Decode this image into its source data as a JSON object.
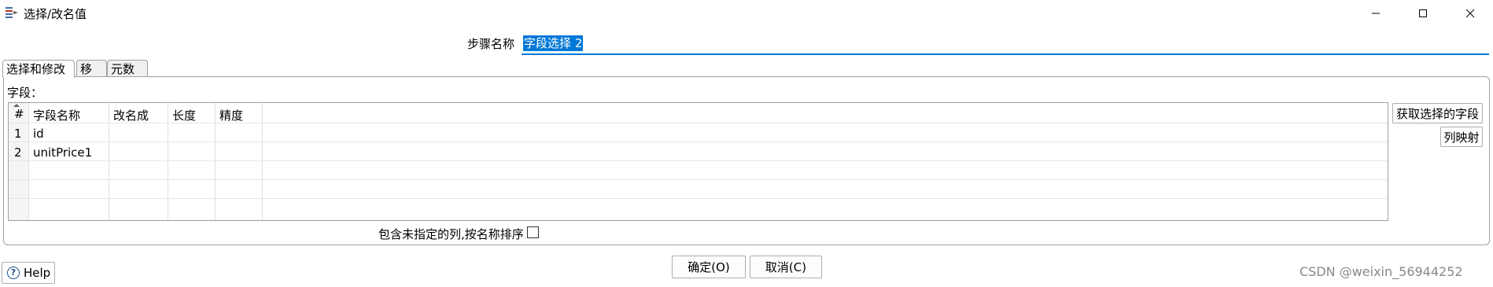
{
  "window": {
    "title": "选择/改名值",
    "icon": "select-values-icon"
  },
  "step": {
    "label": "步骤名称",
    "value": "字段选择 2"
  },
  "tabs": [
    {
      "label": "选择和修改",
      "active": true
    },
    {
      "label": "移除",
      "active": false
    },
    {
      "label": "元数据",
      "active": false
    }
  ],
  "fields_label": "字段：",
  "table": {
    "headers": [
      "#",
      "字段名称",
      "改名成",
      "长度",
      "精度"
    ],
    "rows": [
      {
        "num": "1",
        "name": "id",
        "rename": "",
        "length": "",
        "precision": ""
      },
      {
        "num": "2",
        "name": "unitPrice1",
        "rename": "",
        "length": "",
        "precision": ""
      }
    ]
  },
  "buttons": {
    "get_fields": "获取选择的字段",
    "column_mapping": "列映射",
    "help": "Help",
    "ok": "确定(O)",
    "cancel": "取消(C)"
  },
  "include_unspecified": {
    "label": "包含未指定的列,按名称排序",
    "checked": false
  },
  "watermark": "CSDN @weixin_56944252"
}
